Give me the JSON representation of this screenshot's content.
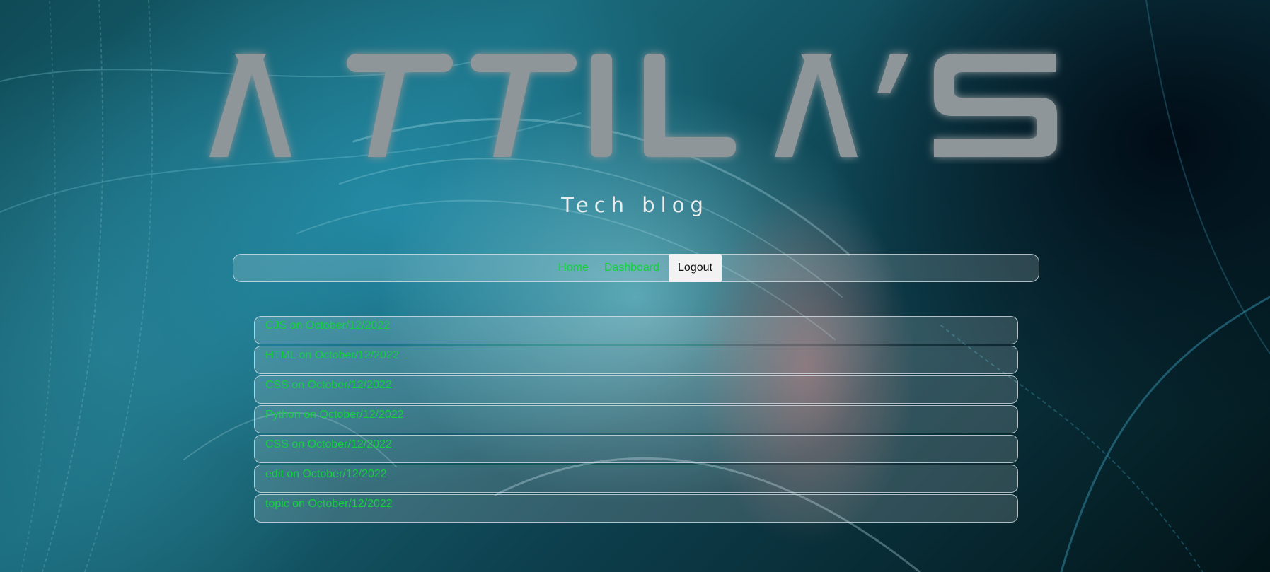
{
  "header": {
    "logo_text": "ATTILA'S",
    "subtitle": "Tech blog"
  },
  "nav": {
    "home_label": "Home",
    "dashboard_label": "Dashboard",
    "logout_label": "Logout"
  },
  "posts": [
    {
      "text": "CJS on October/12/2022"
    },
    {
      "text": "HTML on October/12/2022"
    },
    {
      "text": "CSS on October/12/2022"
    },
    {
      "text": "Python on October/12/2022"
    },
    {
      "text": "CSS on October/12/2022"
    },
    {
      "text": "edit on October/12/2022"
    },
    {
      "text": "topic on October/12/2022"
    }
  ],
  "colors": {
    "link": "#14d23a",
    "logo": "#8e969a",
    "subtitle": "#e8eef0"
  }
}
